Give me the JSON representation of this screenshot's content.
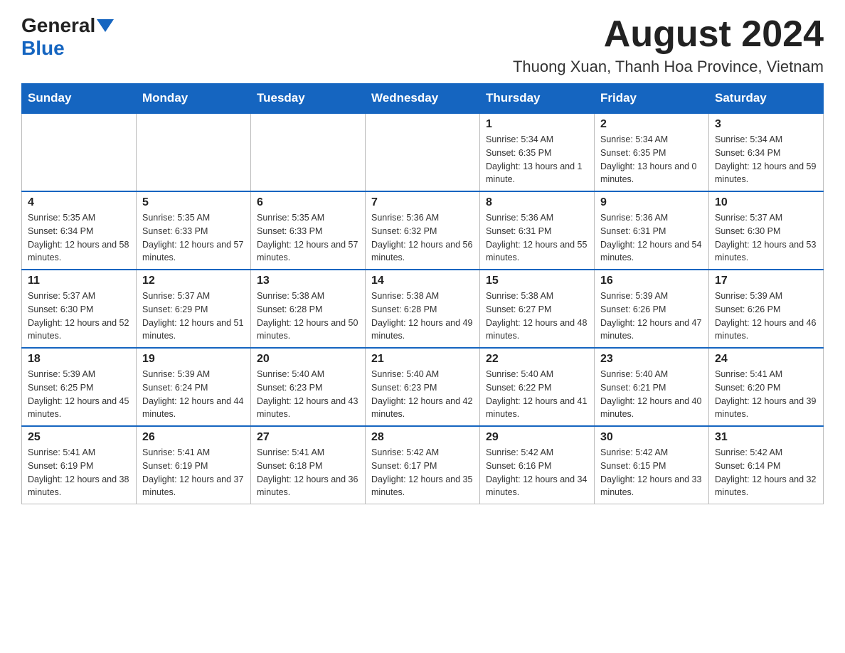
{
  "header": {
    "logo_general": "General",
    "logo_blue": "Blue",
    "month_title": "August 2024",
    "location": "Thuong Xuan, Thanh Hoa Province, Vietnam"
  },
  "weekdays": [
    "Sunday",
    "Monday",
    "Tuesday",
    "Wednesday",
    "Thursday",
    "Friday",
    "Saturday"
  ],
  "weeks": [
    [
      {
        "day": "",
        "info": ""
      },
      {
        "day": "",
        "info": ""
      },
      {
        "day": "",
        "info": ""
      },
      {
        "day": "",
        "info": ""
      },
      {
        "day": "1",
        "info": "Sunrise: 5:34 AM\nSunset: 6:35 PM\nDaylight: 13 hours and 1 minute."
      },
      {
        "day": "2",
        "info": "Sunrise: 5:34 AM\nSunset: 6:35 PM\nDaylight: 13 hours and 0 minutes."
      },
      {
        "day": "3",
        "info": "Sunrise: 5:34 AM\nSunset: 6:34 PM\nDaylight: 12 hours and 59 minutes."
      }
    ],
    [
      {
        "day": "4",
        "info": "Sunrise: 5:35 AM\nSunset: 6:34 PM\nDaylight: 12 hours and 58 minutes."
      },
      {
        "day": "5",
        "info": "Sunrise: 5:35 AM\nSunset: 6:33 PM\nDaylight: 12 hours and 57 minutes."
      },
      {
        "day": "6",
        "info": "Sunrise: 5:35 AM\nSunset: 6:33 PM\nDaylight: 12 hours and 57 minutes."
      },
      {
        "day": "7",
        "info": "Sunrise: 5:36 AM\nSunset: 6:32 PM\nDaylight: 12 hours and 56 minutes."
      },
      {
        "day": "8",
        "info": "Sunrise: 5:36 AM\nSunset: 6:31 PM\nDaylight: 12 hours and 55 minutes."
      },
      {
        "day": "9",
        "info": "Sunrise: 5:36 AM\nSunset: 6:31 PM\nDaylight: 12 hours and 54 minutes."
      },
      {
        "day": "10",
        "info": "Sunrise: 5:37 AM\nSunset: 6:30 PM\nDaylight: 12 hours and 53 minutes."
      }
    ],
    [
      {
        "day": "11",
        "info": "Sunrise: 5:37 AM\nSunset: 6:30 PM\nDaylight: 12 hours and 52 minutes."
      },
      {
        "day": "12",
        "info": "Sunrise: 5:37 AM\nSunset: 6:29 PM\nDaylight: 12 hours and 51 minutes."
      },
      {
        "day": "13",
        "info": "Sunrise: 5:38 AM\nSunset: 6:28 PM\nDaylight: 12 hours and 50 minutes."
      },
      {
        "day": "14",
        "info": "Sunrise: 5:38 AM\nSunset: 6:28 PM\nDaylight: 12 hours and 49 minutes."
      },
      {
        "day": "15",
        "info": "Sunrise: 5:38 AM\nSunset: 6:27 PM\nDaylight: 12 hours and 48 minutes."
      },
      {
        "day": "16",
        "info": "Sunrise: 5:39 AM\nSunset: 6:26 PM\nDaylight: 12 hours and 47 minutes."
      },
      {
        "day": "17",
        "info": "Sunrise: 5:39 AM\nSunset: 6:26 PM\nDaylight: 12 hours and 46 minutes."
      }
    ],
    [
      {
        "day": "18",
        "info": "Sunrise: 5:39 AM\nSunset: 6:25 PM\nDaylight: 12 hours and 45 minutes."
      },
      {
        "day": "19",
        "info": "Sunrise: 5:39 AM\nSunset: 6:24 PM\nDaylight: 12 hours and 44 minutes."
      },
      {
        "day": "20",
        "info": "Sunrise: 5:40 AM\nSunset: 6:23 PM\nDaylight: 12 hours and 43 minutes."
      },
      {
        "day": "21",
        "info": "Sunrise: 5:40 AM\nSunset: 6:23 PM\nDaylight: 12 hours and 42 minutes."
      },
      {
        "day": "22",
        "info": "Sunrise: 5:40 AM\nSunset: 6:22 PM\nDaylight: 12 hours and 41 minutes."
      },
      {
        "day": "23",
        "info": "Sunrise: 5:40 AM\nSunset: 6:21 PM\nDaylight: 12 hours and 40 minutes."
      },
      {
        "day": "24",
        "info": "Sunrise: 5:41 AM\nSunset: 6:20 PM\nDaylight: 12 hours and 39 minutes."
      }
    ],
    [
      {
        "day": "25",
        "info": "Sunrise: 5:41 AM\nSunset: 6:19 PM\nDaylight: 12 hours and 38 minutes."
      },
      {
        "day": "26",
        "info": "Sunrise: 5:41 AM\nSunset: 6:19 PM\nDaylight: 12 hours and 37 minutes."
      },
      {
        "day": "27",
        "info": "Sunrise: 5:41 AM\nSunset: 6:18 PM\nDaylight: 12 hours and 36 minutes."
      },
      {
        "day": "28",
        "info": "Sunrise: 5:42 AM\nSunset: 6:17 PM\nDaylight: 12 hours and 35 minutes."
      },
      {
        "day": "29",
        "info": "Sunrise: 5:42 AM\nSunset: 6:16 PM\nDaylight: 12 hours and 34 minutes."
      },
      {
        "day": "30",
        "info": "Sunrise: 5:42 AM\nSunset: 6:15 PM\nDaylight: 12 hours and 33 minutes."
      },
      {
        "day": "31",
        "info": "Sunrise: 5:42 AM\nSunset: 6:14 PM\nDaylight: 12 hours and 32 minutes."
      }
    ]
  ]
}
